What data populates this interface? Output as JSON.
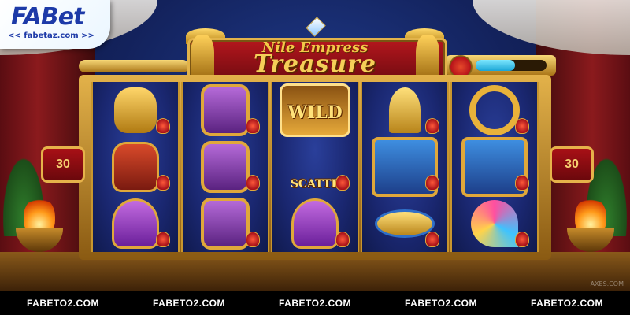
{
  "brand": {
    "logo_text": "FABet",
    "logo_subtitle": "<< fabetaz.com >>"
  },
  "game": {
    "title_line1": "Nile Empress",
    "title_line2": "Treasure",
    "progress_fraction": 0.55
  },
  "lines": {
    "left": "30",
    "right": "30"
  },
  "reels": [
    {
      "symbols": [
        "bast",
        "anubis",
        "lotus"
      ]
    },
    {
      "symbols": [
        "vulture",
        "vulture",
        "vulture"
      ]
    },
    {
      "symbols": [
        "wild",
        "scatter",
        "lotus"
      ]
    },
    {
      "symbols": [
        "ankh",
        "queen",
        "eye"
      ]
    },
    {
      "symbols": [
        "ring",
        "queen",
        "fan"
      ]
    }
  ],
  "symbol_text": {
    "wild": "WILD",
    "scatter": "SCATTE"
  },
  "watermark": {
    "items": [
      "FABETO2.COM",
      "FABETO2.COM",
      "FABETO2.COM",
      "FABETO2.COM",
      "FABETO2.COM"
    ],
    "corner": "AXES.COM"
  }
}
